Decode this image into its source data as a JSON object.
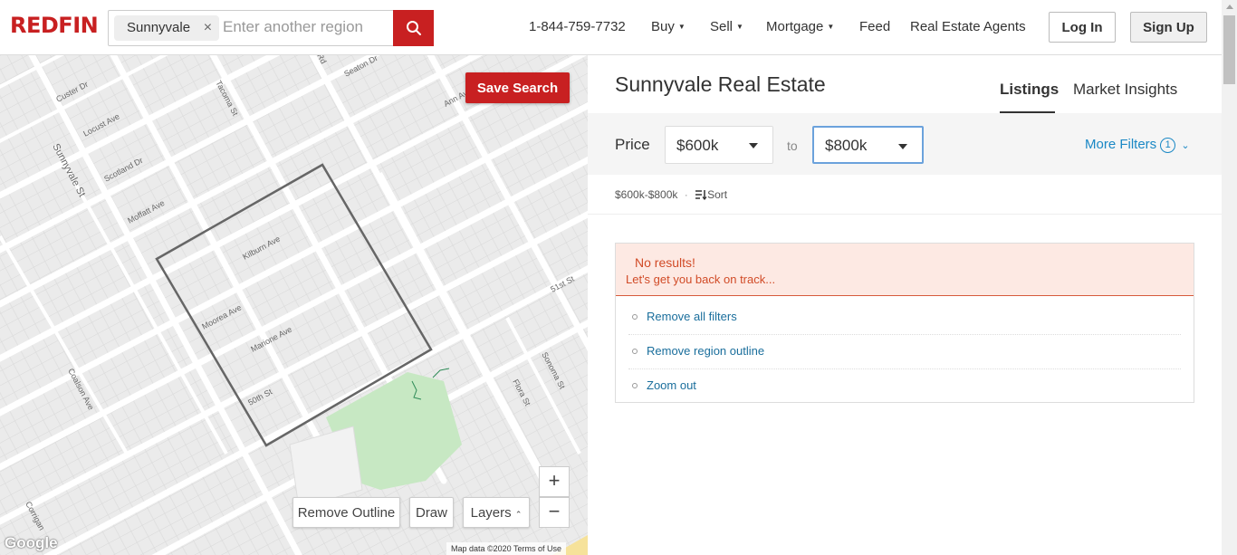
{
  "header": {
    "logo": "REDFIN",
    "search_chip": "Sunnyvale",
    "search_placeholder": "Enter another region",
    "phone": "1-844-759-7732",
    "nav": [
      {
        "label": "Buy",
        "dropdown": true
      },
      {
        "label": "Sell",
        "dropdown": true
      },
      {
        "label": "Mortgage",
        "dropdown": true
      },
      {
        "label": "Feed",
        "dropdown": false
      },
      {
        "label": "Real Estate Agents",
        "dropdown": false
      }
    ],
    "login": "Log In",
    "signup": "Sign Up"
  },
  "map": {
    "save_search": "Save Search",
    "remove_outline": "Remove Outline",
    "draw": "Draw",
    "layers": "Layers",
    "zoom_in": "+",
    "zoom_out": "−",
    "google": "Google",
    "attribution": "Map data ©2020   Terms of Use",
    "street_labels": [
      "Sunnyvale St",
      "Custer Dr",
      "Locust Ave",
      "Scotland Dr",
      "Moffatt Ave",
      "Tacoma St",
      "Seaton Dr",
      "Ann Ave",
      "Kilburn Ave",
      "Moorea Ave",
      "Marione Ave",
      "50th St",
      "51st St",
      "Coalson Ave",
      "Sonoma St",
      "Flora St",
      "Corrigan",
      "Rd"
    ]
  },
  "panel": {
    "title": "Sunnyvale Real Estate",
    "tabs": [
      "Listings",
      "Market Insights"
    ],
    "active_tab": "Listings",
    "price_label": "Price",
    "price_min": "$600k",
    "price_max": "$800k",
    "to": "to",
    "more_filters": "More Filters",
    "filter_count": "1",
    "summary_range": "$600k-$800k",
    "summary_sep": "·",
    "sort": "Sort",
    "alert": {
      "title": "No results!",
      "subtitle": "Let's get you back on track...",
      "items": [
        "Remove all filters",
        "Remove region outline",
        "Zoom out"
      ]
    }
  },
  "colors": {
    "brand_red": "#c82021",
    "link_blue": "#1a88c5",
    "alert_bg": "#fde9e3",
    "alert_text": "#d14b27",
    "focus_border": "#6ba2dc"
  }
}
